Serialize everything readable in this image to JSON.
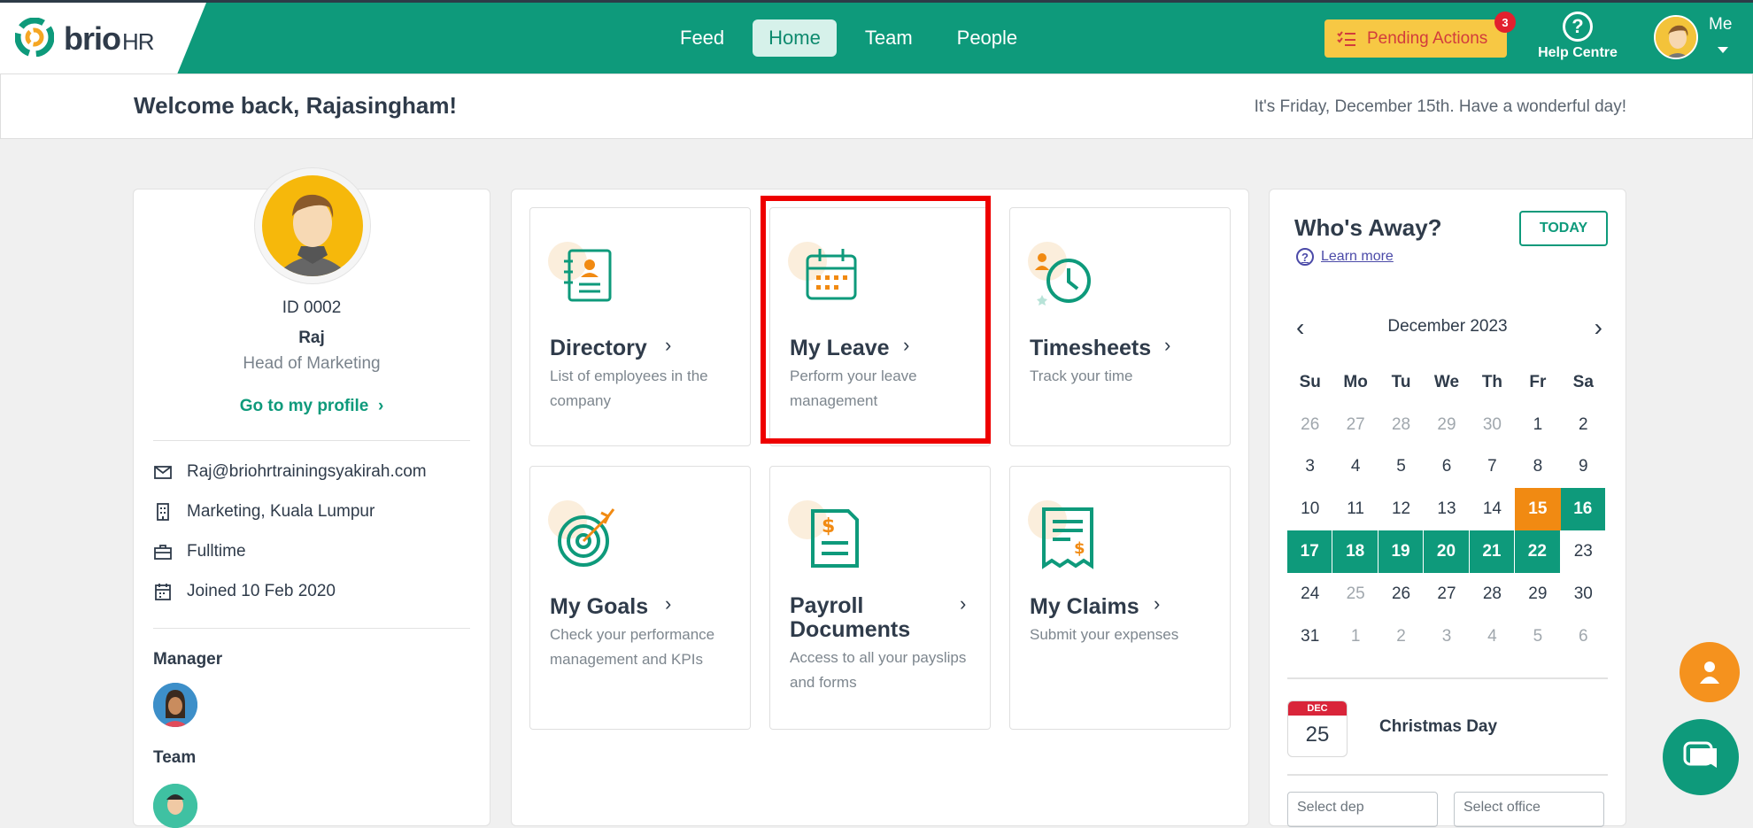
{
  "brand": {
    "name": "brio",
    "suffix": "HR"
  },
  "nav": {
    "items": [
      "Feed",
      "Home",
      "Team",
      "People"
    ],
    "active": "Home"
  },
  "header": {
    "pending_label": "Pending Actions",
    "pending_count": "3",
    "help_label": "Help Centre",
    "me_label": "Me"
  },
  "welcome": {
    "title": "Welcome back, Rajasingham!",
    "date_text": "It's Friday, December 15th. Have a wonderful day!"
  },
  "profile": {
    "id": "ID 0002",
    "name": "Raj",
    "role": "Head of Marketing",
    "profile_link": "Go to my profile",
    "email": "Raj@briohrtrainingsyakirah.com",
    "location": "Marketing, Kuala Lumpur",
    "employment": "Fulltime",
    "joined": "Joined 10 Feb 2020",
    "manager_label": "Manager",
    "team_label": "Team"
  },
  "tiles": [
    {
      "title": "Directory",
      "desc": "List of employees in the company"
    },
    {
      "title": "My Leave",
      "desc": "Perform your leave management"
    },
    {
      "title": "Timesheets",
      "desc": "Track your time"
    },
    {
      "title": "My Goals",
      "desc": "Check your performance management and KPIs"
    },
    {
      "title": "Payroll Documents",
      "desc": "Access to all your payslips and forms"
    },
    {
      "title": "My Claims",
      "desc": "Submit your expenses"
    }
  ],
  "away": {
    "title": "Who's Away?",
    "today_button": "TODAY",
    "learn_more": "Learn more",
    "month": "December 2023",
    "weekdays": [
      "Su",
      "Mo",
      "Tu",
      "We",
      "Th",
      "Fr",
      "Sa"
    ],
    "weeks": [
      [
        "26",
        "27",
        "28",
        "29",
        "30",
        "1",
        "2"
      ],
      [
        "3",
        "4",
        "5",
        "6",
        "7",
        "8",
        "9"
      ],
      [
        "10",
        "11",
        "12",
        "13",
        "14",
        "15",
        "16"
      ],
      [
        "17",
        "18",
        "19",
        "20",
        "21",
        "22",
        "23"
      ],
      [
        "24",
        "25",
        "26",
        "27",
        "28",
        "29",
        "30"
      ],
      [
        "31",
        "1",
        "2",
        "3",
        "4",
        "5",
        "6"
      ]
    ],
    "today_day": "15",
    "away_days": [
      "16",
      "17",
      "18",
      "19",
      "20",
      "21",
      "22"
    ],
    "holiday": {
      "month": "DEC",
      "day": "25",
      "name": "Christmas Day"
    },
    "department_select": "Select dep",
    "office_select": "Select office"
  },
  "colors": {
    "primary": "#0e9a7b",
    "accent": "#f18a12",
    "pending_bg": "#f7c844",
    "highlight": "#ee0000"
  }
}
